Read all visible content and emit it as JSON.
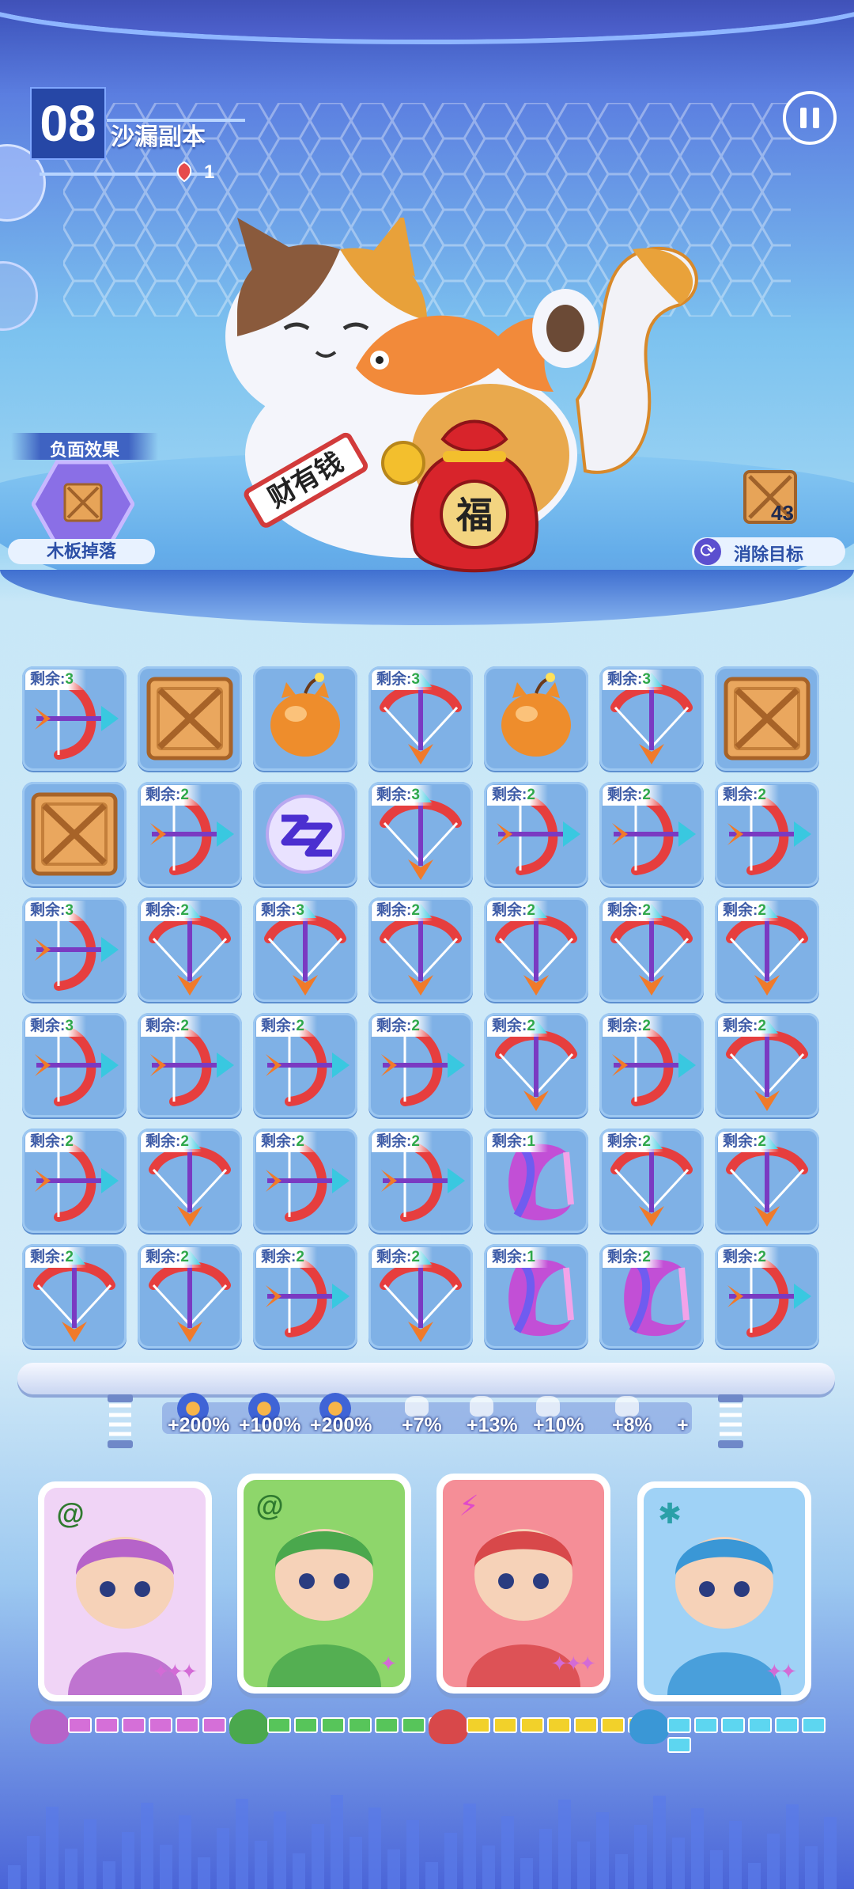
{
  "level": {
    "number": "08",
    "name": "沙漏副本",
    "leaf_count": "1"
  },
  "debuff": {
    "title": "负面效果",
    "name": "木板掉落"
  },
  "target": {
    "count": "43",
    "label": "消除目标"
  },
  "boss": {
    "sign_text": "财有钱",
    "bag_text": "福"
  },
  "board": {
    "remain_prefix": "剩余:",
    "rows": [
      [
        {
          "t": "bow",
          "r": "3"
        },
        {
          "t": "crate"
        },
        {
          "t": "bomb"
        },
        {
          "t": "xbow",
          "r": "3"
        },
        {
          "t": "bomb"
        },
        {
          "t": "xbow",
          "r": "3"
        },
        {
          "t": "crate"
        }
      ],
      [
        {
          "t": "crate"
        },
        {
          "t": "bow",
          "r": "2"
        },
        {
          "t": "orb"
        },
        {
          "t": "xbow",
          "r": "3"
        },
        {
          "t": "bow",
          "r": "2"
        },
        {
          "t": "bow",
          "r": "2"
        },
        {
          "t": "bow",
          "r": "2"
        }
      ],
      [
        {
          "t": "bow",
          "r": "3"
        },
        {
          "t": "xbow",
          "r": "2"
        },
        {
          "t": "xbow",
          "r": "3"
        },
        {
          "t": "xbow",
          "r": "2"
        },
        {
          "t": "xbow",
          "r": "2"
        },
        {
          "t": "xbow",
          "r": "2"
        },
        {
          "t": "xbow",
          "r": "2"
        }
      ],
      [
        {
          "t": "bow",
          "r": "3"
        },
        {
          "t": "bow",
          "r": "2"
        },
        {
          "t": "bow",
          "r": "2"
        },
        {
          "t": "bow",
          "r": "2"
        },
        {
          "t": "xbow",
          "r": "2"
        },
        {
          "t": "bow",
          "r": "2"
        },
        {
          "t": "xbow",
          "r": "2"
        }
      ],
      [
        {
          "t": "bow",
          "r": "2"
        },
        {
          "t": "xbow",
          "r": "2"
        },
        {
          "t": "bow",
          "r": "2"
        },
        {
          "t": "bow",
          "r": "2"
        },
        {
          "t": "boomerang",
          "r": "1"
        },
        {
          "t": "xbow",
          "r": "2"
        },
        {
          "t": "xbow",
          "r": "2"
        }
      ],
      [
        {
          "t": "xbow",
          "r": "2"
        },
        {
          "t": "xbow",
          "r": "2"
        },
        {
          "t": "bow",
          "r": "2"
        },
        {
          "t": "xbow",
          "r": "2"
        },
        {
          "t": "boomerang",
          "r": "1"
        },
        {
          "t": "boomerang",
          "r": "2"
        },
        {
          "t": "bow",
          "r": "2"
        }
      ]
    ]
  },
  "bonuses": [
    "+200%",
    "+100%",
    "+200%",
    "+7%",
    "+13%",
    "+10%",
    "+8%",
    "+"
  ],
  "heroes": [
    {
      "name": "hero-goggles-girl",
      "element": "spiral",
      "stars": "✦✦✦",
      "bar_color": "#d56fd8",
      "bg": "#f0d4f6",
      "pet_color": "#b663c9"
    },
    {
      "name": "hero-opera-general",
      "element": "spiral",
      "stars": "✦",
      "bar_color": "#57c55a",
      "bg": "#8ed66b",
      "pet_color": "#4aa84d"
    },
    {
      "name": "hero-skull-girl",
      "element": "lightning",
      "stars": "✦✦✦",
      "bar_color": "#f2d12a",
      "bg": "#f58e97",
      "pet_color": "#d8484a"
    },
    {
      "name": "hero-knight-bot",
      "element": "frost",
      "stars": "✦✦",
      "bar_color": "#5dd6f0",
      "bg": "#9fd2f6",
      "pet_color": "#3a97d6"
    }
  ],
  "colors": {
    "accent": "#2b4fa6",
    "energy_segments": 7
  }
}
